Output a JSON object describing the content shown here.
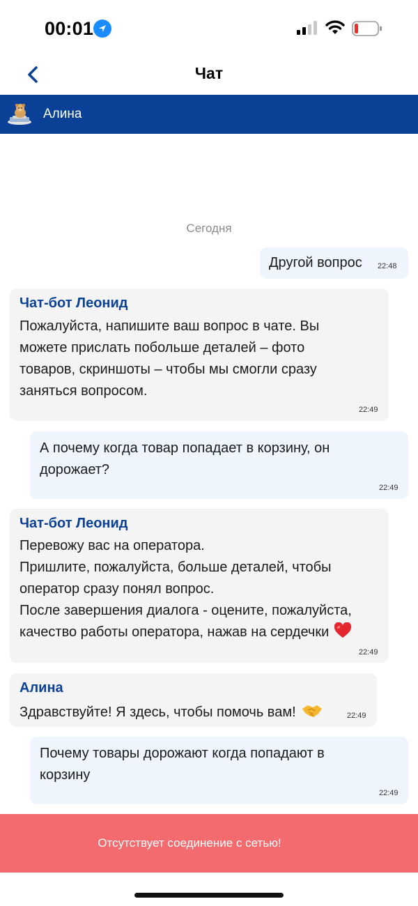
{
  "status_bar": {
    "time": "00:01",
    "battery_color": "#e5322d"
  },
  "nav": {
    "title": "Чат"
  },
  "operator": {
    "name": "Алина",
    "bar_color": "#0a4196"
  },
  "chat": {
    "date_separator": "Сегодня",
    "messages": [
      {
        "direction": "out",
        "text": "Другой вопрос",
        "time": "22:48"
      },
      {
        "direction": "in",
        "sender": "Чат-бот Леонид",
        "lines": [
          "Пожалуйста, напишите ваш вопрос в чате. Вы",
          "можете прислать побольше деталей – фото",
          "товаров, скриншоты – чтобы мы смогли сразу",
          "заняться вопросом."
        ],
        "time": "22:49"
      },
      {
        "direction": "out",
        "lines": [
          "А почему когда товар попадает в корзину, он",
          "дорожает?"
        ],
        "time": "22:49"
      },
      {
        "direction": "in",
        "sender": "Чат-бот Леонид",
        "lines": [
          "Перевожу вас на оператора.",
          "Пришлите, пожалуйста, больше деталей, чтобы",
          "оператор сразу понял вопрос.",
          "После завершения диалога - оцените, пожалуйста,",
          "качество работы оператора, нажав на сердечки"
        ],
        "emoji": "heart",
        "time": "22:49"
      },
      {
        "direction": "in",
        "sender": "Алина",
        "text": "Здравствуйте! Я здесь, чтобы помочь вам!",
        "emoji": "handshake",
        "time": "22:49"
      },
      {
        "direction": "out",
        "lines": [
          "Почему товары дорожают когда попадают в",
          "корзину"
        ],
        "time": "22:49"
      }
    ]
  },
  "banner": {
    "text": "Отсутствует соединение с сетью!",
    "color": "#f36b6e"
  }
}
